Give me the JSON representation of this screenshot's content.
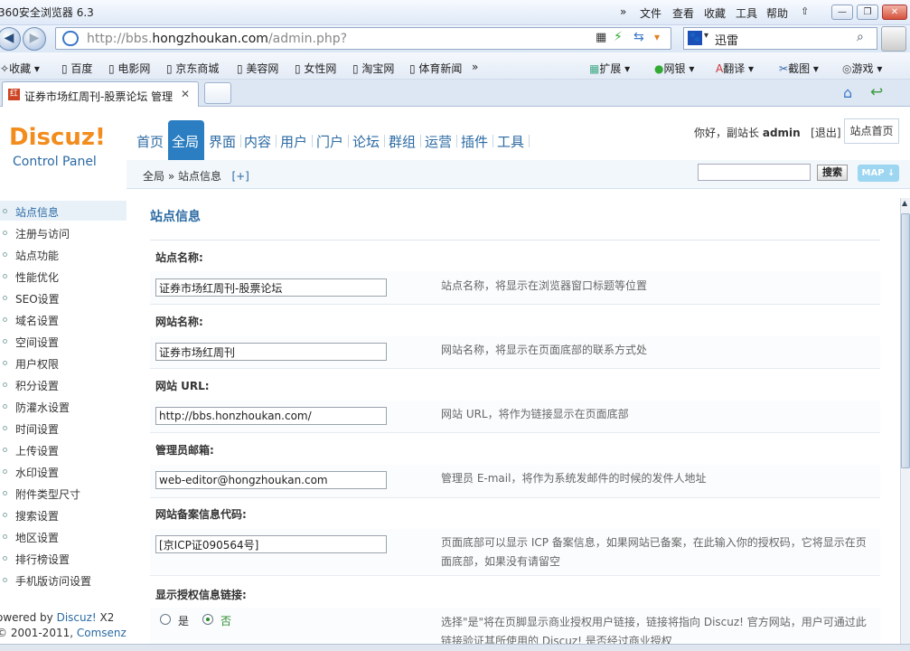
{
  "browser": {
    "title": "360安全浏览器 6.3",
    "menu": [
      "文件",
      "查看",
      "收藏",
      "工具",
      "帮助"
    ],
    "overflow": "»",
    "url_prefix": "http://bbs.",
    "url_host": "hongzhoukan.com",
    "url_suffix": "/admin.php?",
    "search_engine": "迅雷",
    "favorites": [
      "收藏",
      "百度",
      "电影网",
      "京东商城",
      "美容网",
      "女性网",
      "淘宝网",
      "体育新闻"
    ],
    "fav_overflow": "»",
    "tools": [
      "扩展",
      "网银",
      "翻译",
      "截图",
      "游戏"
    ],
    "tab_title": "证券市场红周刊-股票论坛 管理"
  },
  "header": {
    "logo": "Discuz!",
    "logo_sub": "Control Panel",
    "nav": [
      "首页",
      "全局",
      "界面",
      "内容",
      "用户",
      "门户",
      "论坛",
      "群组",
      "运营",
      "插件",
      "工具"
    ],
    "active_nav": "全局",
    "greeting_prefix": "你好，副站长",
    "user": "admin",
    "logout": "[退出]",
    "home_button": "站点首页"
  },
  "breadcrumb": {
    "path": "全局 » 站点信息",
    "toggle": "[+]",
    "search_button": "搜索",
    "map_button": "MAP ↓"
  },
  "sidebar": {
    "items": [
      "站点信息",
      "注册与访问",
      "站点功能",
      "性能优化",
      "SEO设置",
      "域名设置",
      "空间设置",
      "用户权限",
      "积分设置",
      "防灌水设置",
      "时间设置",
      "上传设置",
      "水印设置",
      "附件类型尺寸",
      "搜索设置",
      "地区设置",
      "排行榜设置",
      "手机版访问设置"
    ],
    "active": "站点信息",
    "powered_prefix": "owered by",
    "powered_link": "Discuz!",
    "powered_version": "X2",
    "copyright_prefix": "© 2001-2011,",
    "copyright_link": "Comsenz Inc."
  },
  "main": {
    "title": "站点信息",
    "fields": [
      {
        "label": "站点名称:",
        "value": "证券市场红周刊-股票论坛",
        "desc": "站点名称，将显示在浏览器窗口标题等位置"
      },
      {
        "label": "网站名称:",
        "value": "证券市场红周刊",
        "desc": "网站名称，将显示在页面底部的联系方式处"
      },
      {
        "label": "网站 URL:",
        "value": "http://bbs.honzhoukan.com/",
        "desc": "网站 URL，将作为链接显示在页面底部"
      },
      {
        "label": "管理员邮箱:",
        "value": "web-editor@hongzhoukan.com",
        "desc": "管理员 E-mail，将作为系统发邮件的时候的发件人地址"
      },
      {
        "label": "网站备案信息代码:",
        "value": "[京ICP证090564号]",
        "desc": "页面底部可以显示 ICP 备案信息，如果网站已备案，在此输入你的授权码，它将显示在页",
        "desc2": "面底部，如果没有请留空"
      }
    ],
    "license": {
      "label": "显示授权信息链接:",
      "yes": "是",
      "no": "否",
      "selected": "否",
      "desc": "选择\"是\"将在页脚显示商业授权用户链接，链接将指向 Discuz! 官方网站，用户可通过此",
      "desc2": "链接验证其所使用的 Discuz! 是否经过商业授权"
    }
  },
  "colors": {
    "accent": "#2b6aa3",
    "nav_active_bg": "#2b7ec1",
    "logo": "#f28c1d"
  }
}
